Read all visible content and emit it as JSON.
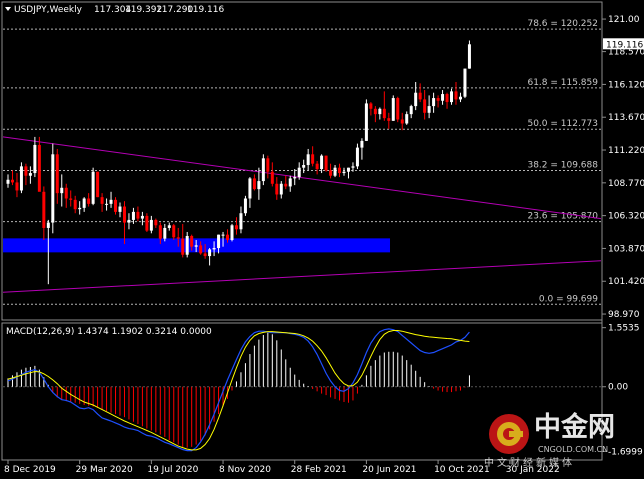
{
  "colors": {
    "bull": "#ffffff",
    "bear": "#ff0000",
    "fib": "#b4b4b4",
    "trend": "#b400b4",
    "zone": "#0000ff",
    "signal": "#ffff00",
    "macd_hist": "#ffffff",
    "macd_line": "#1e50ff",
    "grid": "#8c8c8c"
  },
  "chart_data": [
    {
      "type": "candlestick",
      "title": "USDJPY,Weekly",
      "ohlc_readout": [
        "117.304",
        "119.392",
        "117.290",
        "119.116"
      ],
      "last_price": "119.116",
      "y_ticks": [
        "121.00",
        "118.570",
        "116.120",
        "113.670",
        "111.220",
        "108.770",
        "106.320",
        "103.870",
        "101.420",
        "98.970"
      ],
      "x_ticks": [
        "8 Dec 2019",
        "29 Mar 2020",
        "19 Jul 2020",
        "8 Nov 2020",
        "28 Feb 2021",
        "20 Jun 2021",
        "10 Oct 2021",
        "30 Jan 2022"
      ],
      "ylim": [
        98.6,
        122.2
      ],
      "fibonacci": [
        {
          "label": "78.6 = 120.252",
          "value": 120.252
        },
        {
          "label": "61.8 = 115.859",
          "value": 115.859
        },
        {
          "label": "50.0 = 112.773",
          "value": 112.773
        },
        {
          "label": "38.2 = 109.688",
          "value": 109.688
        },
        {
          "label": "23.6 = 105.870",
          "value": 105.87
        },
        {
          "label": "0.0 = 99.699",
          "value": 99.699
        }
      ],
      "support_zone": {
        "low": 103.6,
        "high": 104.6,
        "from": "8 Dec 2019",
        "to": "20 Aug 2021"
      },
      "trendlines": [
        {
          "from": {
            "week": 0,
            "price": 112.2
          },
          "to": {
            "week": 118,
            "price": 106.1
          }
        },
        {
          "from": {
            "week": 0,
            "price": 100.6
          },
          "to": {
            "week": 118,
            "price": 102.95
          }
        }
      ],
      "x_week_range": [
        0,
        118
      ],
      "candles": [
        [
          108.7,
          109.4,
          108.4,
          109.0
        ],
        [
          109.0,
          109.7,
          108.6,
          108.8
        ],
        [
          108.8,
          109.5,
          107.7,
          108.2
        ],
        [
          108.2,
          110.3,
          108.0,
          110.0
        ],
        [
          110.0,
          110.2,
          108.6,
          109.3
        ],
        [
          109.3,
          110.0,
          108.7,
          109.5
        ],
        [
          109.5,
          112.2,
          109.2,
          111.6
        ],
        [
          111.6,
          112.2,
          108.2,
          108.1
        ],
        [
          108.1,
          108.5,
          104.5,
          105.4
        ],
        [
          105.4,
          106.0,
          101.2,
          105.8
        ],
        [
          105.8,
          111.7,
          105.0,
          110.9
        ],
        [
          110.9,
          111.3,
          107.2,
          108.0
        ],
        [
          108.0,
          109.4,
          107.0,
          108.4
        ],
        [
          108.4,
          108.7,
          106.9,
          107.6
        ],
        [
          107.6,
          108.2,
          107.0,
          107.5
        ],
        [
          107.5,
          107.8,
          106.5,
          106.8
        ],
        [
          106.8,
          107.4,
          106.4,
          106.9
        ],
        [
          106.9,
          107.7,
          106.6,
          107.6
        ],
        [
          107.6,
          108.0,
          107.0,
          107.2
        ],
        [
          107.2,
          109.9,
          107.1,
          109.6
        ],
        [
          109.6,
          109.6,
          107.7,
          107.7
        ],
        [
          107.7,
          108.0,
          106.6,
          107.2
        ],
        [
          107.2,
          107.6,
          106.7,
          107.2
        ],
        [
          107.2,
          108.1,
          106.9,
          107.5
        ],
        [
          107.5,
          107.7,
          106.4,
          106.6
        ],
        [
          106.6,
          107.3,
          106.2,
          107.0
        ],
        [
          107.0,
          107.4,
          104.2,
          105.8
        ],
        [
          105.8,
          106.5,
          105.3,
          106.0
        ],
        [
          106.0,
          106.9,
          105.7,
          106.6
        ],
        [
          106.6,
          107.0,
          105.9,
          106.1
        ],
        [
          106.1,
          106.6,
          105.6,
          106.3
        ],
        [
          106.3,
          106.5,
          105.1,
          105.2
        ],
        [
          105.2,
          106.3,
          105.0,
          106.0
        ],
        [
          106.0,
          106.1,
          105.4,
          105.6
        ],
        [
          105.6,
          105.8,
          104.2,
          104.6
        ],
        [
          104.6,
          105.7,
          104.4,
          105.4
        ],
        [
          105.4,
          105.8,
          105.2,
          105.6
        ],
        [
          105.6,
          105.7,
          104.5,
          104.7
        ],
        [
          104.7,
          105.4,
          104.0,
          104.6
        ],
        [
          104.6,
          105.7,
          103.2,
          103.4
        ],
        [
          103.4,
          105.1,
          103.2,
          104.8
        ],
        [
          104.8,
          104.9,
          103.7,
          104.0
        ],
        [
          104.0,
          104.5,
          103.6,
          104.1
        ],
        [
          104.1,
          104.4,
          103.4,
          103.5
        ],
        [
          103.5,
          104.2,
          103.1,
          103.3
        ],
        [
          103.3,
          103.9,
          102.6,
          103.8
        ],
        [
          103.8,
          104.4,
          103.3,
          103.9
        ],
        [
          103.9,
          104.9,
          103.5,
          104.9
        ],
        [
          104.9,
          105.1,
          104.0,
          104.9
        ],
        [
          104.9,
          105.3,
          104.3,
          104.5
        ],
        [
          104.5,
          105.7,
          104.4,
          105.6
        ],
        [
          105.6,
          106.2,
          104.9,
          105.3
        ],
        [
          105.3,
          107.0,
          105.0,
          106.5
        ],
        [
          106.5,
          107.8,
          106.3,
          107.6
        ],
        [
          107.6,
          109.2,
          106.9,
          109.1
        ],
        [
          109.1,
          109.4,
          108.2,
          108.3
        ],
        [
          108.3,
          109.9,
          107.5,
          108.9
        ],
        [
          108.9,
          110.9,
          108.6,
          110.6
        ],
        [
          110.6,
          110.8,
          109.1,
          109.6
        ],
        [
          109.6,
          110.3,
          108.5,
          108.7
        ],
        [
          108.7,
          109.2,
          107.5,
          107.9
        ],
        [
          107.9,
          108.9,
          107.6,
          108.7
        ],
        [
          108.7,
          109.3,
          108.3,
          108.5
        ],
        [
          108.5,
          109.3,
          108.1,
          109.1
        ],
        [
          109.1,
          109.8,
          108.6,
          109.2
        ],
        [
          109.2,
          110.3,
          109.0,
          109.9
        ],
        [
          109.9,
          110.5,
          109.5,
          110.1
        ],
        [
          110.1,
          111.3,
          109.7,
          110.9
        ],
        [
          110.9,
          111.5,
          110.0,
          110.2
        ],
        [
          110.2,
          110.4,
          109.4,
          109.8
        ],
        [
          109.8,
          110.9,
          109.5,
          110.8
        ],
        [
          110.8,
          110.8,
          109.6,
          109.7
        ],
        [
          109.7,
          110.2,
          109.1,
          109.3
        ],
        [
          109.3,
          110.1,
          109.2,
          109.9
        ],
        [
          109.9,
          110.2,
          109.2,
          109.5
        ],
        [
          109.5,
          109.9,
          109.3,
          109.6
        ],
        [
          109.6,
          109.9,
          109.1,
          109.9
        ],
        [
          109.9,
          110.3,
          109.6,
          110.0
        ],
        [
          110.0,
          111.7,
          109.8,
          111.4
        ],
        [
          111.4,
          112.1,
          110.5,
          111.9
        ],
        [
          111.9,
          115.0,
          111.9,
          114.7
        ],
        [
          114.7,
          114.8,
          113.8,
          114.3
        ],
        [
          114.3,
          114.5,
          113.3,
          113.9
        ],
        [
          113.9,
          114.4,
          113.5,
          114.3
        ],
        [
          114.3,
          115.6,
          113.4,
          113.6
        ],
        [
          113.6,
          114.0,
          112.8,
          113.4
        ],
        [
          113.4,
          115.3,
          113.4,
          115.1
        ],
        [
          115.1,
          115.2,
          113.3,
          113.5
        ],
        [
          113.5,
          114.0,
          112.7,
          113.2
        ],
        [
          113.2,
          114.1,
          113.1,
          113.9
        ],
        [
          113.9,
          114.6,
          113.6,
          114.5
        ],
        [
          114.5,
          116.3,
          114.2,
          115.5
        ],
        [
          115.5,
          116.2,
          114.8,
          115.0
        ],
        [
          115.0,
          115.7,
          113.5,
          114.0
        ],
        [
          114.0,
          115.3,
          113.6,
          114.5
        ],
        [
          114.5,
          115.5,
          114.0,
          115.1
        ],
        [
          115.1,
          115.3,
          114.4,
          114.9
        ],
        [
          114.9,
          115.7,
          114.6,
          115.4
        ],
        [
          115.4,
          115.5,
          114.3,
          114.8
        ],
        [
          114.8,
          115.8,
          114.6,
          115.6
        ],
        [
          115.6,
          116.3,
          114.6,
          115.0
        ],
        [
          115.0,
          115.5,
          114.8,
          115.2
        ],
        [
          115.2,
          117.3,
          115.1,
          117.3
        ],
        [
          117.3,
          119.4,
          117.29,
          119.116
        ]
      ]
    },
    {
      "type": "macd",
      "title": "MACD(12,26,9) 1.4374 1.1902 0.3214 0.0000",
      "y_ticks": [
        "1.5535",
        "0.00",
        "-1.6999"
      ],
      "ylim": [
        -1.9,
        1.65
      ],
      "histogram": [
        0.22,
        0.3,
        0.38,
        0.45,
        0.5,
        0.52,
        0.55,
        0.45,
        0.25,
        0.05,
        -0.15,
        -0.28,
        -0.35,
        -0.38,
        -0.4,
        -0.42,
        -0.45,
        -0.48,
        -0.5,
        -0.52,
        -0.55,
        -0.6,
        -0.64,
        -0.68,
        -0.72,
        -0.76,
        -0.8,
        -0.86,
        -0.92,
        -0.98,
        -1.04,
        -1.1,
        -1.15,
        -1.2,
        -1.26,
        -1.32,
        -1.4,
        -1.46,
        -1.52,
        -1.58,
        -1.6,
        -1.58,
        -1.52,
        -1.42,
        -1.28,
        -1.12,
        -0.92,
        -0.72,
        -0.52,
        -0.32,
        -0.1,
        0.14,
        0.38,
        0.62,
        0.86,
        1.08,
        1.24,
        1.36,
        1.42,
        1.38,
        1.22,
        0.98,
        0.72,
        0.5,
        0.32,
        0.18,
        0.08,
        0.02,
        -0.06,
        -0.12,
        -0.18,
        -0.22,
        -0.28,
        -0.32,
        -0.36,
        -0.4,
        -0.42,
        -0.36,
        -0.18,
        0.05,
        0.3,
        0.55,
        0.7,
        0.82,
        0.9,
        0.92,
        0.92,
        0.9,
        0.82,
        0.7,
        0.58,
        0.42,
        0.26,
        0.12,
        0.02,
        -0.05,
        -0.1,
        -0.13,
        -0.14,
        -0.14,
        -0.12,
        -0.1,
        -0.02,
        0.3
      ],
      "macd_line": [
        0.15,
        0.2,
        0.26,
        0.32,
        0.38,
        0.42,
        0.45,
        0.38,
        0.2,
        0.0,
        -0.15,
        -0.26,
        -0.34,
        -0.36,
        -0.4,
        -0.48,
        -0.56,
        -0.58,
        -0.55,
        -0.6,
        -0.72,
        -0.82,
        -0.86,
        -0.9,
        -0.95,
        -1.0,
        -1.06,
        -1.1,
        -1.12,
        -1.15,
        -1.22,
        -1.28,
        -1.3,
        -1.34,
        -1.4,
        -1.46,
        -1.5,
        -1.55,
        -1.6,
        -1.65,
        -1.68,
        -1.68,
        -1.6,
        -1.45,
        -1.25,
        -1.0,
        -0.72,
        -0.42,
        -0.12,
        0.18,
        0.45,
        0.72,
        0.98,
        1.18,
        1.32,
        1.42,
        1.46,
        1.46,
        1.44,
        1.42,
        1.42,
        1.42,
        1.42,
        1.4,
        1.38,
        1.35,
        1.3,
        1.2,
        1.05,
        0.85,
        0.6,
        0.35,
        0.15,
        0.0,
        -0.1,
        -0.12,
        -0.05,
        0.1,
        0.32,
        0.6,
        0.9,
        1.15,
        1.32,
        1.45,
        1.5,
        1.52,
        1.5,
        1.45,
        1.35,
        1.25,
        1.15,
        1.05,
        0.95,
        0.9,
        0.88,
        0.9,
        0.95,
        1.0,
        1.05,
        1.1,
        1.18,
        1.22,
        1.3,
        1.4374
      ],
      "signal_line": [
        0.2,
        0.23,
        0.27,
        0.3,
        0.34,
        0.37,
        0.4,
        0.39,
        0.34,
        0.27,
        0.18,
        0.08,
        -0.04,
        -0.12,
        -0.2,
        -0.27,
        -0.34,
        -0.4,
        -0.44,
        -0.48,
        -0.54,
        -0.6,
        -0.66,
        -0.72,
        -0.78,
        -0.84,
        -0.9,
        -0.95,
        -1.0,
        -1.05,
        -1.1,
        -1.15,
        -1.2,
        -1.26,
        -1.32,
        -1.38,
        -1.44,
        -1.5,
        -1.56,
        -1.6,
        -1.64,
        -1.66,
        -1.66,
        -1.62,
        -1.52,
        -1.36,
        -1.12,
        -0.82,
        -0.5,
        -0.16,
        0.18,
        0.5,
        0.8,
        1.04,
        1.22,
        1.34,
        1.4,
        1.43,
        1.45,
        1.45,
        1.44,
        1.43,
        1.42,
        1.41,
        1.4,
        1.38,
        1.34,
        1.28,
        1.2,
        1.08,
        0.94,
        0.76,
        0.56,
        0.36,
        0.2,
        0.08,
        0.02,
        0.03,
        0.12,
        0.3,
        0.54,
        0.8,
        1.04,
        1.24,
        1.38,
        1.45,
        1.48,
        1.48,
        1.46,
        1.43,
        1.4,
        1.37,
        1.35,
        1.33,
        1.31,
        1.3,
        1.29,
        1.28,
        1.27,
        1.26,
        1.24,
        1.22,
        1.2,
        1.1902
      ]
    }
  ],
  "watermark": {
    "name": "中金网",
    "tagline": "中文财经新媒体",
    "url": "CNGOLD.COM.CN"
  }
}
